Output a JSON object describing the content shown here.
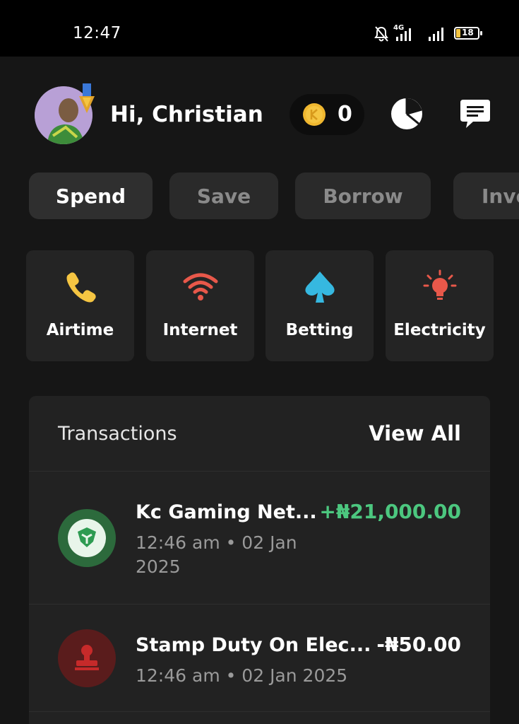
{
  "status_bar": {
    "time": "12:47",
    "network": "4G",
    "battery": "18",
    "icons": [
      "mute-bell-icon",
      "signal-4g-icon",
      "signal-icon",
      "battery-icon"
    ]
  },
  "header": {
    "greeting": "Hi, Christian",
    "coin_count": "0",
    "icons": [
      "avatar",
      "coin-icon",
      "pie-chart-icon",
      "message-icon"
    ]
  },
  "tabs": [
    {
      "label": "Spend",
      "active": true
    },
    {
      "label": "Save",
      "active": false
    },
    {
      "label": "Borrow",
      "active": false
    },
    {
      "label": "Inve",
      "active": false
    }
  ],
  "services": [
    {
      "label": "Airtime",
      "icon": "phone-icon",
      "color": "#f5c542"
    },
    {
      "label": "Internet",
      "icon": "wifi-icon",
      "color": "#e8584a"
    },
    {
      "label": "Betting",
      "icon": "spade-icon",
      "color": "#36b8e0"
    },
    {
      "label": "Electricity",
      "icon": "bulb-icon",
      "color": "#e8584a"
    }
  ],
  "transactions": {
    "title": "Transactions",
    "view_all": "View All",
    "items": [
      {
        "name": "Kc Gaming Net...",
        "time_line1": "12:46 am • 02 Jan",
        "time_line2": "2025",
        "amount": "+₦21,000.00",
        "amount_color": "#4cc77f",
        "icon": "gaming-logo-icon"
      },
      {
        "name": "Stamp Duty On Elec...",
        "time_line1": "12:46 am • 02 Jan 2025",
        "amount": "-₦50.00",
        "amount_color": "#ffffff",
        "icon": "stamp-icon"
      }
    ]
  },
  "colors": {
    "background": "#161616",
    "card": "#222222",
    "positive": "#4cc77f",
    "coin": "#f5c542"
  }
}
